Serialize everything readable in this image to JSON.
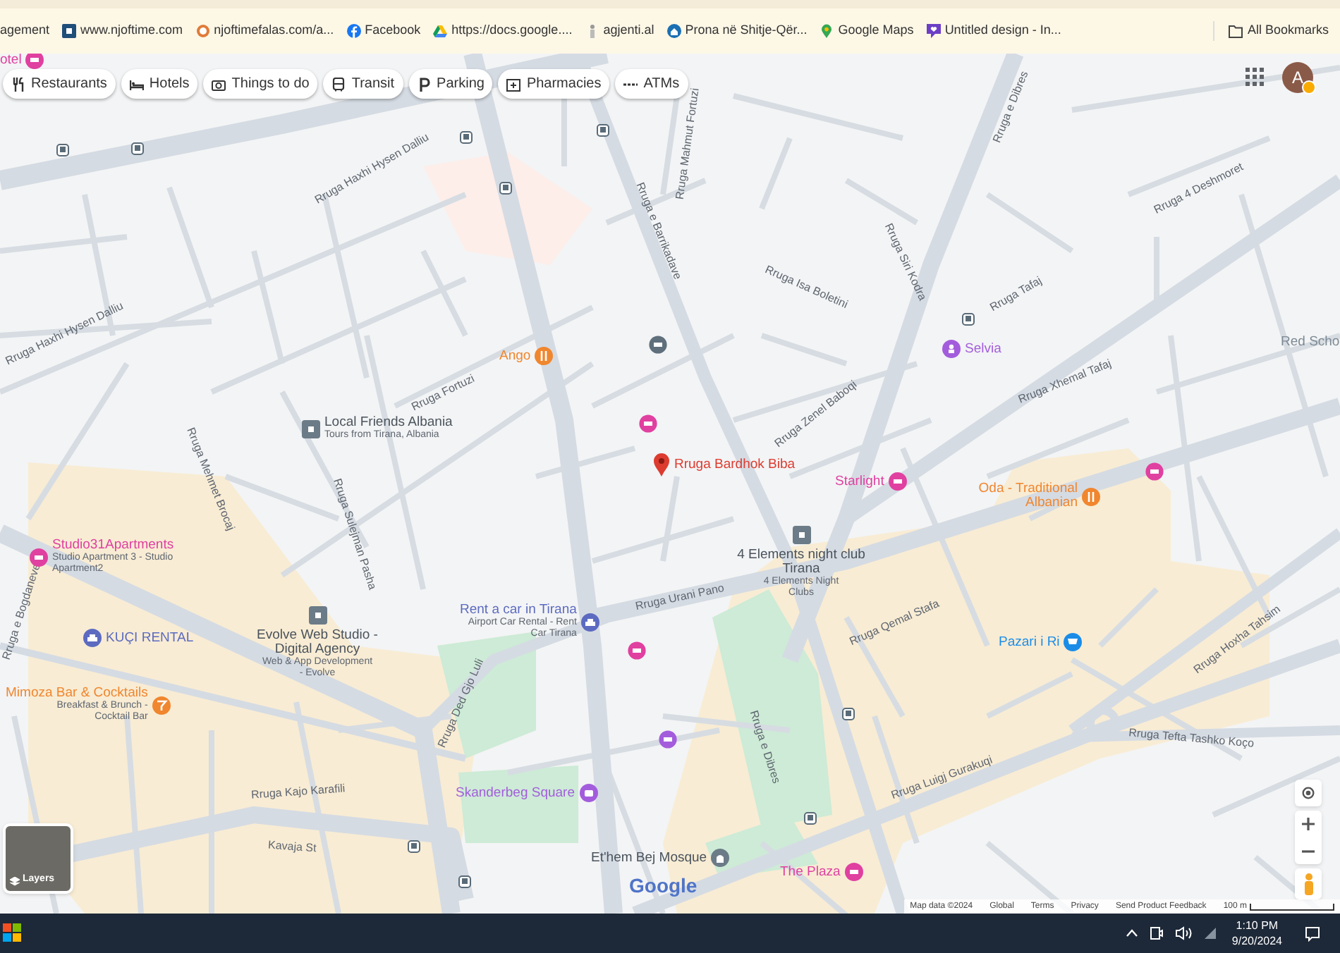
{
  "bookmarks": [
    {
      "label": "agement"
    },
    {
      "label": "www.njoftime.com"
    },
    {
      "label": "njoftimefalas.com/a..."
    },
    {
      "label": "Facebook"
    },
    {
      "label": "https://docs.google...."
    },
    {
      "label": "agjenti.al"
    },
    {
      "label": "Prona në Shitje-Qër..."
    },
    {
      "label": "Google Maps"
    },
    {
      "label": "Untitled design - In..."
    },
    {
      "label": "All Bookmarks"
    }
  ],
  "chips": [
    {
      "label": "Restaurants"
    },
    {
      "label": "Hotels"
    },
    {
      "label": "Things to do"
    },
    {
      "label": "Transit"
    },
    {
      "label": "Parking"
    },
    {
      "label": "Pharmacies"
    },
    {
      "label": "ATMs"
    }
  ],
  "account": {
    "initial": "A",
    "alert": true
  },
  "streets": [
    "Rruga Haxhi Hysen Dalliu",
    "Rruga Haxhi Hysen Dalliu",
    "Rruga Mehmet Brocaj",
    "Rruga Fortuzi",
    "Rruga e Barrikadave",
    "Rruga Mahmut Fortuzi",
    "Rruga e Dibres",
    "Rruga Siri Kodra",
    "Rruga Isa Boletini",
    "Rruga Tafaj",
    "Rruga 4 Deshmoret",
    "Rruga Zenel Baboqi",
    "Rruga Xhemal Tafaj",
    "Rruga Urani Pano",
    "Rruga Qemal Stafa",
    "Rruga Sulejman Pasha",
    "Rruga e Bogdaneve",
    "Rruga Ded Gjo Luli",
    "Rruga Kajo Karafili",
    "Kavaja St",
    "Rruga e Dibres",
    "Rruga Luigj Gurakuqi",
    "Rruga Hoxha Tahsim",
    "Rruga Tefta Tashko Koço"
  ],
  "places": [
    {
      "name": "otel",
      "kind": "hotel",
      "color": "#e040a0"
    },
    {
      "name": "Ango",
      "kind": "food",
      "color": "#f0862e"
    },
    {
      "name": "Local Friends Albania",
      "subtitle": "Tours from Tirana, Albania",
      "kind": "business",
      "color": "#6b7b87"
    },
    {
      "name": "Rruga Bardhok Biba",
      "kind": "pin",
      "color": "#dd3b2f"
    },
    {
      "name": "Selvia",
      "kind": "shop",
      "color": "#a35ddc"
    },
    {
      "name": "Red Scho",
      "kind": "label",
      "color": "#7d8a94"
    },
    {
      "name": "Starlight",
      "kind": "hotel",
      "color": "#e040a0"
    },
    {
      "name": "Oda - Traditional Albanian",
      "kind": "food",
      "color": "#f0862e"
    },
    {
      "name": "Studio31Apartments",
      "subtitle": "Studio Apartment 3 - Studio Apartment2",
      "kind": "hotel",
      "color": "#e040a0"
    },
    {
      "name": "4 Elements night club Tirana",
      "subtitle": "4 Elements Night Clubs",
      "kind": "business",
      "color": "#6b7b87"
    },
    {
      "name": "Evolve Web Studio - Digital Agency",
      "subtitle": "Web & App Development - Evolve",
      "kind": "business",
      "color": "#6b7b87"
    },
    {
      "name": "Rent a car in Tirana",
      "subtitle": "Airport Car Rental - Rent Car Tirana",
      "kind": "car",
      "color": "#5c6bc0"
    },
    {
      "name": "KUÇI RENTAL",
      "kind": "car",
      "color": "#5c6bc0"
    },
    {
      "name": "Pazari i Ri",
      "kind": "cart",
      "color": "#1a8ce8"
    },
    {
      "name": "Mimoza Bar & Cocktails",
      "subtitle": "Breakfast & Brunch - Cocktail Bar",
      "kind": "bar",
      "color": "#f0862e"
    },
    {
      "name": "Skanderbeg Square",
      "kind": "sight",
      "color": "#a35ddc"
    },
    {
      "name": "Et'hem Bej Mosque",
      "kind": "mosque",
      "color": "#6b7b87"
    },
    {
      "name": "The Plaza",
      "kind": "hotel",
      "color": "#e040a0"
    }
  ],
  "layers_button": {
    "label": "Layers"
  },
  "logo": "Google",
  "attribution": [
    "Map data ©2024",
    "Global",
    "Terms",
    "Privacy",
    "Send Product Feedback"
  ],
  "scale": "100 m",
  "taskbar": {
    "time": "1:10 PM",
    "date": "9/20/2024"
  }
}
